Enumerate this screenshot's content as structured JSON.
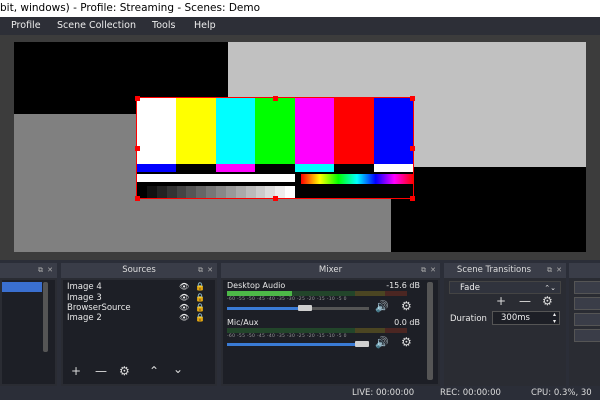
{
  "window": {
    "title": "bit, windows) - Profile: Streaming - Scenes: Demo"
  },
  "menu": {
    "items": [
      "Profile",
      "Scene Collection",
      "Tools",
      "Help"
    ]
  },
  "colors": {
    "bars": [
      "#ffffff",
      "#ffff00",
      "#00ffff",
      "#00ff00",
      "#ff00ff",
      "#ff0000",
      "#0000ff"
    ],
    "strip": [
      "#0000ff",
      "#000000",
      "#ff00ff",
      "#000000",
      "#00ffff",
      "#000000",
      "#ffffff"
    ],
    "steps": [
      "#000000",
      "#111111",
      "#222222",
      "#333333",
      "#444444",
      "#555555",
      "#666666",
      "#777777",
      "#888888",
      "#999999",
      "#aaaaaa",
      "#bbbbbb",
      "#cccccc",
      "#dddddd",
      "#eeeeee",
      "#ffffff"
    ]
  },
  "sources": {
    "title": "Sources",
    "items": [
      {
        "label": "Image 4"
      },
      {
        "label": "Image 3"
      },
      {
        "label": "BrowserSource"
      },
      {
        "label": "Image 2"
      }
    ],
    "toolbar_icons": [
      "plus-icon",
      "minus-icon",
      "gear-icon",
      "chevron-up-icon",
      "chevron-down-icon"
    ]
  },
  "mixer": {
    "title": "Mixer",
    "channels": [
      {
        "name": "Desktop Audio",
        "db": "-15.6 dB",
        "level": 0.36,
        "volume": 0.56
      },
      {
        "name": "Mic/Aux",
        "db": "0.0 dB",
        "level": 0.0,
        "volume": 0.91
      }
    ],
    "ticks": "-60 -55 -50 -45 -40 -35 -30 -25 -20 -15 -10 -5 0"
  },
  "transitions": {
    "title": "Scene Transitions",
    "selected": "Fade",
    "duration_label": "Duration",
    "duration_value": "300ms"
  },
  "status": {
    "live": "LIVE: 00:00:00",
    "rec": "REC: 00:00:00",
    "cpu": "CPU: 0.3%, 30"
  }
}
